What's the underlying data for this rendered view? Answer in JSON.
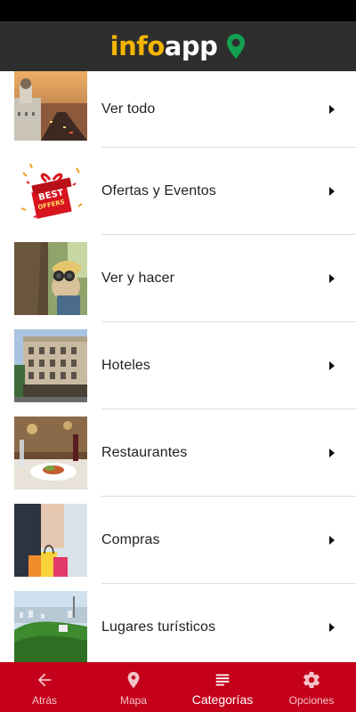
{
  "header": {
    "logo_part1": "info",
    "logo_part2": "app",
    "logo_icon": "location-pin-icon",
    "colors": {
      "logo_info": "#f5b400",
      "logo_app": "#ffffff",
      "pin": "#12a150",
      "background": "#2e2e2e"
    }
  },
  "categories": [
    {
      "label": "Ver todo",
      "thumbnail": "city-street-photo"
    },
    {
      "label": "Ofertas y Eventos",
      "thumbnail": "best-offers-gift-image",
      "thumbnail_text": "BEST OFFERS"
    },
    {
      "label": "Ver y hacer",
      "thumbnail": "binoculars-photo"
    },
    {
      "label": "Hoteles",
      "thumbnail": "hotel-building-photo"
    },
    {
      "label": "Restaurantes",
      "thumbnail": "restaurant-table-photo"
    },
    {
      "label": "Compras",
      "thumbnail": "shopping-bags-photo"
    },
    {
      "label": "Lugares turísticos",
      "thumbnail": "aerial-city-photo"
    }
  ],
  "bottom_nav": {
    "items": [
      {
        "label": "Atrás",
        "icon": "arrow-left-icon"
      },
      {
        "label": "Mapa",
        "icon": "map-pin-icon"
      },
      {
        "label": "Categorías",
        "icon": "list-icon",
        "active": true
      },
      {
        "label": "Opciones",
        "icon": "gear-icon"
      }
    ],
    "background": "#c4001b"
  }
}
